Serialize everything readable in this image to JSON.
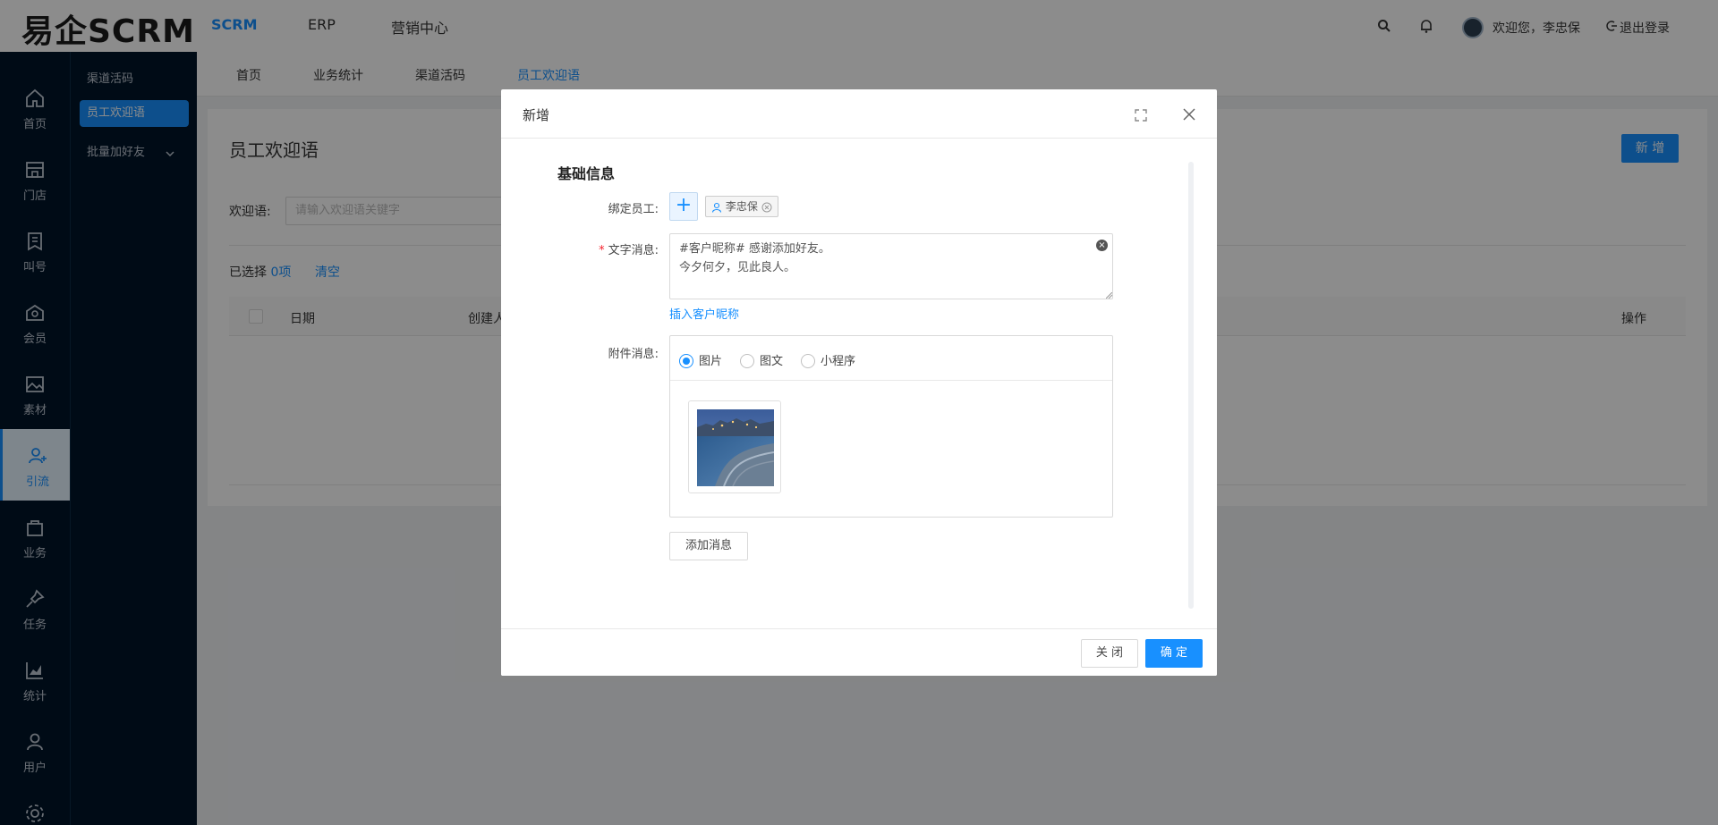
{
  "app": {
    "logo": "易企SCRM"
  },
  "topnav": [
    {
      "label": "SCRM"
    },
    {
      "label": "ERP"
    },
    {
      "label": "营销中心"
    }
  ],
  "user": {
    "welcome": "欢迎您，李忠保",
    "logout": "退出登录"
  },
  "iconnav": [
    {
      "label": "首页",
      "icon": "home-icon"
    },
    {
      "label": "门店",
      "icon": "store-icon"
    },
    {
      "label": "叫号",
      "icon": "ticket-icon"
    },
    {
      "label": "会员",
      "icon": "member-icon"
    },
    {
      "label": "素材",
      "icon": "image-icon"
    },
    {
      "label": "引流",
      "icon": "user-plus-icon"
    },
    {
      "label": "业务",
      "icon": "bag-icon"
    },
    {
      "label": "任务",
      "icon": "pin-icon"
    },
    {
      "label": "统计",
      "icon": "chart-icon"
    },
    {
      "label": "用户",
      "icon": "user-icon"
    }
  ],
  "subnav": [
    {
      "label": "渠道活码"
    },
    {
      "label": "员工欢迎语"
    },
    {
      "label": "批量加好友"
    }
  ],
  "tabs": [
    {
      "label": "首页"
    },
    {
      "label": "业务统计"
    },
    {
      "label": "渠道活码"
    },
    {
      "label": "员工欢迎语"
    }
  ],
  "page": {
    "title": "员工欢迎语",
    "new_label": "新 增",
    "filter_label": "欢迎语:",
    "filter_placeholder": "请输入欢迎语关键字",
    "selected_prefix": "已选择",
    "selected_count": "0项",
    "clear_label": "清空",
    "columns": [
      "日期",
      "创建人",
      "操作"
    ]
  },
  "dialog": {
    "title": "新增",
    "section": "基础信息",
    "staff_label": "绑定员工:",
    "staff_add": "+",
    "staff_tag": "李忠保",
    "text_label": "文字消息:",
    "text_value": "#客户昵称# 感谢添加好友。\n今夕何夕，见此良人。",
    "insert_link": "插入客户昵称",
    "attach_label": "附件消息:",
    "attach_options": [
      "图片",
      "图文",
      "小程序"
    ],
    "attach_selected": "图片",
    "add_message": "添加消息",
    "close_label": "关 闭",
    "ok_label": "确 定"
  },
  "colors": {
    "accent": "#1890ff",
    "sidebar": "#001529",
    "overlay": "rgba(0,0,0,0.45)"
  }
}
